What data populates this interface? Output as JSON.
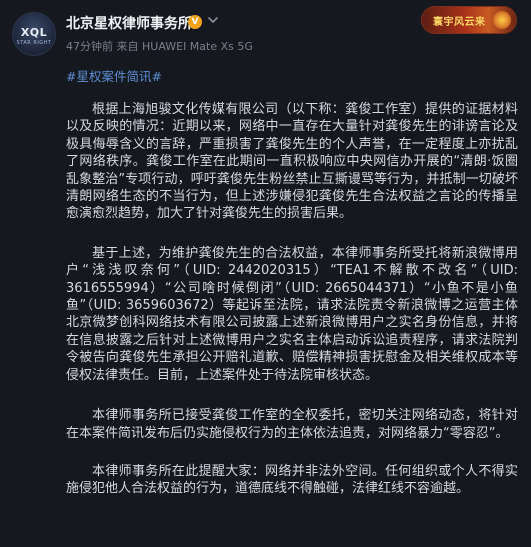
{
  "account": {
    "name": "北京星权律师事务所",
    "avatar_text": "XQL",
    "avatar_sub": "STAR RIGHT",
    "verified_badge": "V",
    "meta": "47分钟前  来自 HUAWEI Mate Xs 5G"
  },
  "sticker": {
    "text": "寰宇风云来"
  },
  "post": {
    "hashtag": "#星权案件简讯#",
    "paragraphs": [
      "根据上海旭骏文化传媒有限公司（以下称：龚俊工作室）提供的证据材料以及反映的情况：近期以来，网络中一直存在大量针对龚俊先生的诽谤言论及极具侮辱含义的言辞，严重损害了龚俊先生的个人声誉，在一定程度上亦扰乱了网络秩序。龚俊工作室在此期间一直积极响应中央网信办开展的“清朗·饭圈乱象整治”专项行动，呼吁龚俊先生粉丝禁止互撕谩骂等行为，并抵制一切破坏清朗网络生态的不当行为，但上述涉嫌侵犯龚俊先生合法权益之言论的传播呈愈演愈烈趋势，加大了针对龚俊先生的损害后果。",
      "基于上述，为维护龚俊先生的合法权益，本律师事务所受托将新浪微博用户“浅浅叹奈何”（UID: 2442020315）“TEA1不解散不改名”（UID: 3616555994）“公司啥时候倒闭”（UID: 2665044371）“小鱼不是小鱼鱼”（UID: 3659603672）等起诉至法院，请求法院责令新浪微博之运营主体北京微梦创科网络技术有限公司披露上述新浪微博用户之实名身份信息，并将在信息披露之后针对上述微博用户之实名主体启动诉讼追责程序，请求法院判令被告向龚俊先生承担公开赔礼道歉、赔偿精神损害抚慰金及相关维权成本等侵权法律责任。目前，上述案件处于待法院审核状态。",
      "本律师事务所已接受龚俊工作室的全权委托，密切关注网络动态，将针对在本案件简讯发布后仍实施侵权行为的主体依法追责，对网络暴力“零容忍”。",
      "本律师事务所在此提醒大家：网络并非法外空间。任何组织或个人不得实施侵犯他人合法权益的行为，道德底线不得触碰，法律红线不容逾越。"
    ]
  },
  "colors": {
    "background": "#15181f",
    "hashtag": "#5e8fd6",
    "verified": "#f3a21b"
  }
}
